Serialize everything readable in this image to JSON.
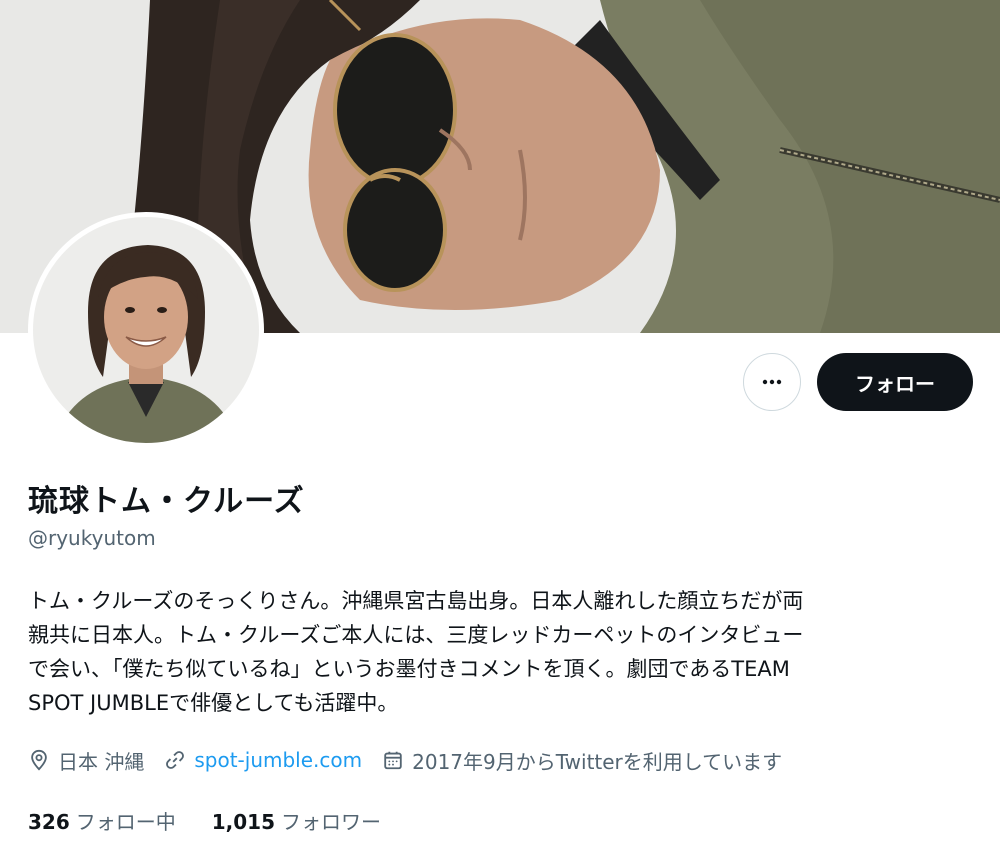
{
  "profile": {
    "display_name": "琉球トム・クルーズ",
    "handle": "@ryukyutom",
    "bio_lines": [
      "トム・クルーズのそっくりさん。沖縄県宮古島出身。日本人離れした顔立ちだが両",
      "親共に日本人。トム・クルーズご本人には、三度レッドカーペットのインタビュー",
      "で会い、「僕たち似ているね」というお墨付きコメントを頂く。劇団であるTEAM",
      "SPOT JUMBLEで俳優としても活躍中。"
    ],
    "location": "日本 沖縄",
    "website": "spot-jumble.com",
    "joined": "2017年9月からTwitterを利用しています"
  },
  "actions": {
    "more_icon": "more-horizontal-icon",
    "follow_label": "フォロー"
  },
  "stats": {
    "following_count": "326",
    "following_label": "フォロー中",
    "followers_count": "1,015",
    "followers_label": "フォロワー"
  },
  "colors": {
    "text_primary": "#0f1419",
    "text_secondary": "#536471",
    "link": "#1d9bf0",
    "follow_button_bg": "#0f1419"
  },
  "icons": {
    "location": "location-pin-icon",
    "website": "link-icon",
    "joined": "calendar-icon"
  }
}
